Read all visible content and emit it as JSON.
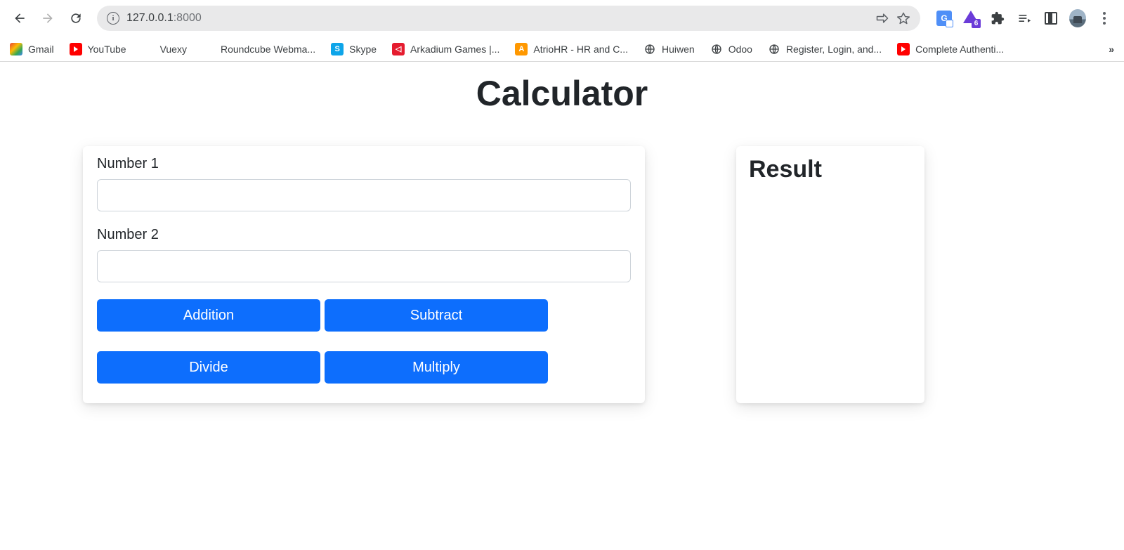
{
  "browser": {
    "url_host": "127.0.0.1",
    "url_rest": ":8000",
    "idm_badge": "6"
  },
  "bookmarks": {
    "items": [
      {
        "label": "Gmail"
      },
      {
        "label": "YouTube"
      },
      {
        "label": "Vuexy"
      },
      {
        "label": "Roundcube Webma..."
      },
      {
        "label": "Skype"
      },
      {
        "label": "Arkadium Games |..."
      },
      {
        "label": "AtrioHR - HR and C..."
      },
      {
        "label": "Huiwen"
      },
      {
        "label": "Odoo"
      },
      {
        "label": "Register, Login, and..."
      },
      {
        "label": "Complete Authenti..."
      }
    ],
    "overflow": "»"
  },
  "page": {
    "title": "Calculator",
    "form": {
      "number1_label": "Number 1",
      "number1_value": "",
      "number2_label": "Number 2",
      "number2_value": ""
    },
    "buttons": {
      "addition": "Addition",
      "subtract": "Subtract",
      "divide": "Divide",
      "multiply": "Multiply"
    },
    "result_heading": "Result"
  }
}
